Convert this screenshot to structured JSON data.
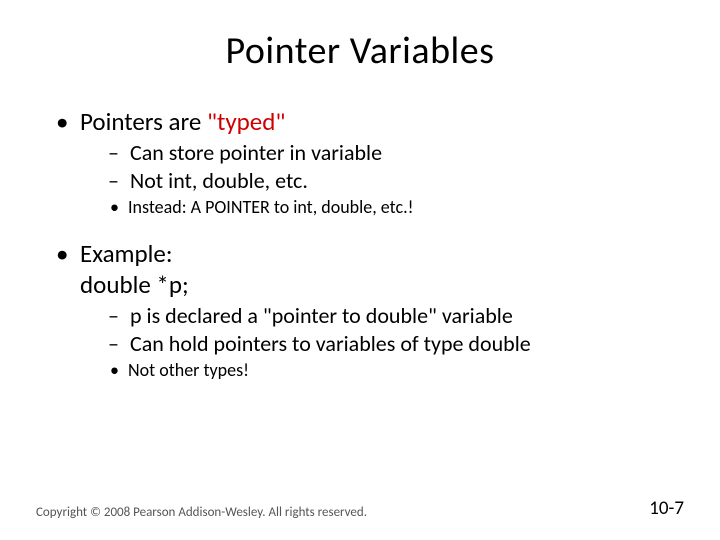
{
  "title": "Pointer Variables",
  "bullets": {
    "b1_prefix": "Pointers are ",
    "b1_typed": "\"typed\"",
    "b1_s1": "Can store pointer in variable",
    "b1_s2": "Not int, double, etc.",
    "b1_ss1": "Instead: A POINTER to int, double, etc.!",
    "b2_line1": "Example:",
    "b2_line2": "double *p;",
    "b2_s1": "p is declared a \"pointer to double\" variable",
    "b2_s2": "Can hold pointers to variables of type double",
    "b2_ss1": "Not other types!"
  },
  "footer": {
    "copyright": "Copyright © 2008 Pearson Addison-Wesley. All rights reserved.",
    "pagenum": "10-7"
  }
}
